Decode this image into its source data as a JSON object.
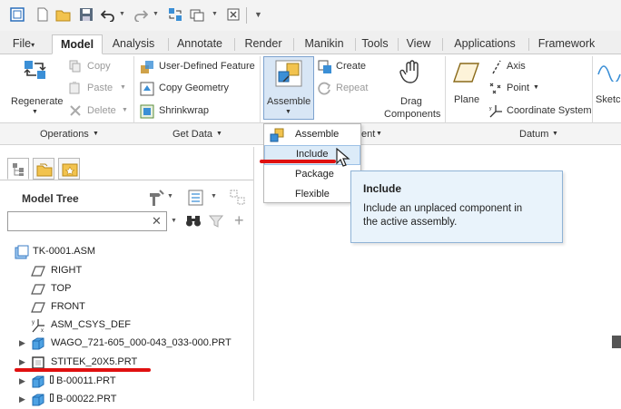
{
  "quick_access": {
    "icons": [
      "window-icon",
      "new-icon",
      "open-icon",
      "save-icon",
      "undo-icon",
      "redo-icon",
      "regenerate-icon",
      "windows-icon",
      "close-window-icon",
      "customize-icon"
    ]
  },
  "tabs": [
    {
      "label": "File",
      "caret": "▾"
    },
    {
      "label": "Model"
    },
    {
      "label": "Analysis"
    },
    {
      "label": "Annotate"
    },
    {
      "label": "Render"
    },
    {
      "label": "Manikin"
    },
    {
      "label": "Tools"
    },
    {
      "label": "View"
    },
    {
      "label": "Applications"
    },
    {
      "label": "Framework"
    }
  ],
  "ribbon": {
    "regenerate": "Regenerate",
    "copy": "Copy",
    "paste": "Paste",
    "delete": "Delete",
    "user_defined_feature": "User-Defined Feature",
    "copy_geometry": "Copy Geometry",
    "shrinkwrap": "Shrinkwrap",
    "assemble": "Assemble",
    "create": "Create",
    "repeat": "Repeat",
    "drag": "Drag",
    "components": "Components",
    "plane": "Plane",
    "axis": "Axis",
    "point": "Point",
    "coordinate_system": "Coordinate System",
    "sketch": "Sketc"
  },
  "groups": {
    "operations": "Operations",
    "get_data": "Get Data",
    "component": "ent",
    "datum": "Datum"
  },
  "assemble_menu": {
    "items": [
      "Assemble",
      "Include",
      "Package",
      "Flexible"
    ],
    "highlighted": "Include"
  },
  "tooltip": {
    "title": "Include",
    "body_line1": "Include an unplaced component in",
    "body_line2": "the active assembly."
  },
  "model_tree": {
    "title": "Model Tree",
    "search_placeholder": "",
    "items": [
      {
        "label": "TK-0001.ASM",
        "icon": "assembly-icon"
      },
      {
        "label": "RIGHT",
        "icon": "datum-plane-icon"
      },
      {
        "label": "TOP",
        "icon": "datum-plane-icon"
      },
      {
        "label": "FRONT",
        "icon": "datum-plane-icon"
      },
      {
        "label": "ASM_CSYS_DEF",
        "icon": "csys-icon"
      },
      {
        "label": "WAGO_721-605_000-043_033-000.PRT",
        "icon": "part-icon"
      },
      {
        "label": "STITEK_20X5.PRT",
        "icon": "unplaced-part-icon"
      },
      {
        "label": "B-00011.PRT",
        "icon": "part-icon"
      },
      {
        "label": "B-00022.PRT",
        "icon": "part-icon"
      }
    ]
  },
  "colors": {
    "accent": "#2a6ebb",
    "highlight": "#dcebf8",
    "annotation_red": "#e01010"
  }
}
